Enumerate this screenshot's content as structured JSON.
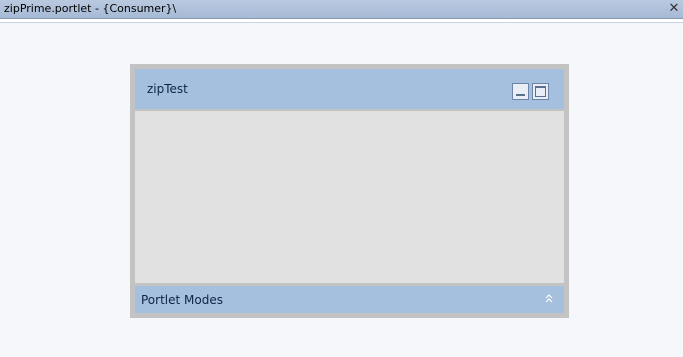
{
  "editor": {
    "tab_title": "zipPrime.portlet - {Consumer}\\",
    "close_glyph": "✕"
  },
  "portlet": {
    "title": "zipTest",
    "minimize_icon": "minimize-icon",
    "maximize_icon": "maximize-icon",
    "footer": {
      "label": "Portlet Modes",
      "collapse_glyph": "»"
    }
  },
  "colors": {
    "tab_bar": "#a7bad6",
    "portlet_header": "#a5bfde",
    "portlet_frame": "#c3c3c3",
    "portlet_body": "#e1e1e1",
    "canvas": "#f5f7fb"
  }
}
